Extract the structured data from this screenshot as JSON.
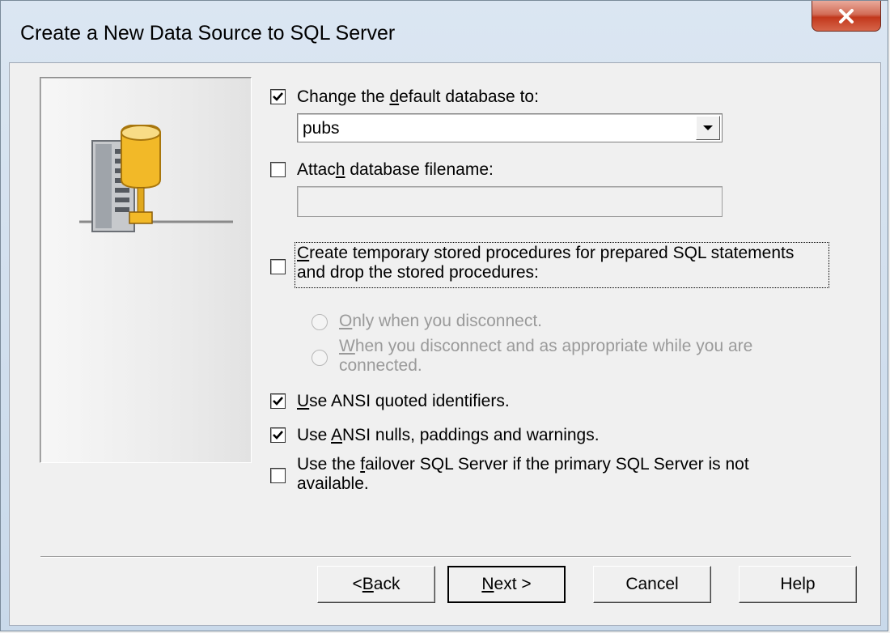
{
  "window": {
    "title": "Create a New Data Source to SQL Server",
    "close_glyph": "x"
  },
  "options": {
    "change_default_db": {
      "checked": true,
      "pre": "Change the ",
      "key": "d",
      "post": "efault database to:"
    },
    "default_db_value": "pubs",
    "attach_db": {
      "checked": false,
      "pre": "Attac",
      "key": "h",
      "post": " database filename:"
    },
    "attach_db_value": "",
    "temp_procs": {
      "checked": false,
      "key": "C",
      "line1_post": "reate temporary stored procedures for prepared SQL statements",
      "line2": "and drop the stored procedures:"
    },
    "radio_only_disconnect": {
      "key": "O",
      "post": "nly when you disconnect."
    },
    "radio_disconnect_appropriate": {
      "key": "W",
      "line1_post": "hen you disconnect and as appropriate while you are",
      "line2": "connected."
    },
    "ansi_quoted": {
      "checked": true,
      "key": "U",
      "post": "se ANSI quoted identifiers."
    },
    "ansi_nulls": {
      "checked": true,
      "pre": "Use ",
      "key": "A",
      "post": "NSI nulls, paddings and warnings."
    },
    "failover": {
      "checked": false,
      "pre": "Use the ",
      "key": "f",
      "line1_post": "ailover SQL Server if the primary SQL Server is not",
      "line2": "available."
    }
  },
  "buttons": {
    "back": {
      "pre": "< ",
      "key": "B",
      "post": "ack"
    },
    "next": {
      "key": "N",
      "post": "ext >"
    },
    "cancel": "Cancel",
    "help": "Help"
  },
  "icons": {
    "server": "server-database-icon",
    "checkmark": "checkmark-icon",
    "dropdown": "chevron-down-icon",
    "close": "close-icon"
  },
  "colors": {
    "close_button": "#c2381c",
    "database_cylinder": "#f2b928",
    "disabled_text": "#9a9a9a"
  }
}
